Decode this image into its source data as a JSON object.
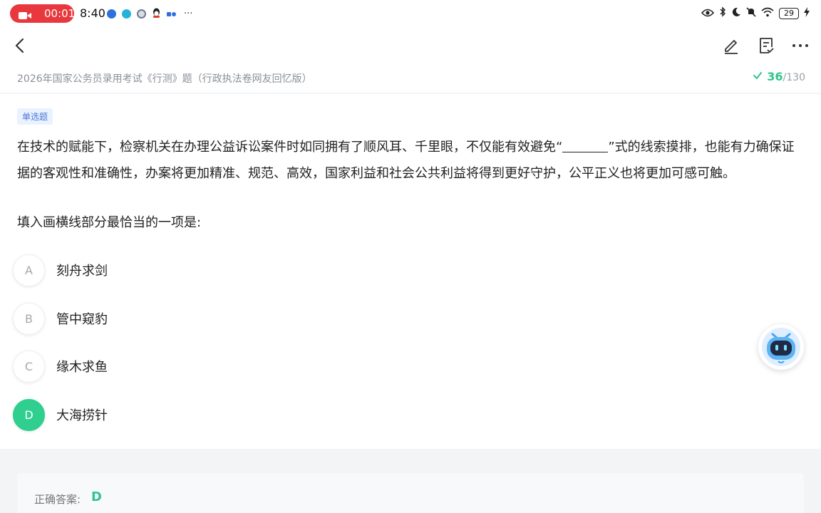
{
  "status_bar": {
    "record_time": "00:01",
    "clock": "8:40",
    "more": "···",
    "battery": "29"
  },
  "header": {
    "subtitle": "2026年国家公务员录用考试《行测》题（行政执法卷网友回忆版）",
    "progress_current": "36",
    "progress_total": "/130"
  },
  "question": {
    "type_tag": "单选题",
    "stem_before": "在技术的赋能下，检察机关在办理公益诉讼案件时如同拥有了顺风耳、千里眼，不仅能有效避免“",
    "stem_after": "”式的线索摸排，也能有力确保证据的客观性和准确性，办案将更加精准、规范、高效，国家利益和社会公共利益将得到更好守护，公平正义也将更加可感可触。",
    "prompt": "填入画横线部分最恰当的一项是:",
    "options": [
      {
        "letter": "A",
        "text": "刻舟求剑"
      },
      {
        "letter": "B",
        "text": "管中窥豹"
      },
      {
        "letter": "C",
        "text": "缘木求鱼"
      },
      {
        "letter": "D",
        "text": "大海捞针"
      }
    ],
    "selected": "D"
  },
  "answer": {
    "label": "正确答案:",
    "value": "D"
  },
  "colors": {
    "accent_green": "#2fcf90",
    "record_red": "#e8383d",
    "tag_blue": "#4a78d8"
  }
}
